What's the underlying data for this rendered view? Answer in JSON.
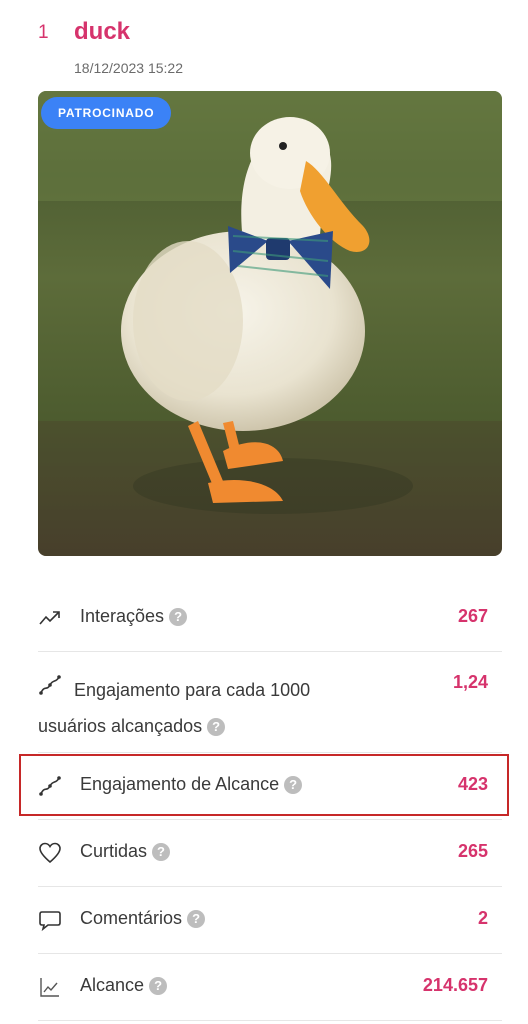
{
  "post": {
    "rank": "1",
    "title": "duck",
    "date": "18/12/2023 15:22",
    "badge": "PATROCINADO"
  },
  "metrics": [
    {
      "label": "Interações",
      "value": "267",
      "icon": "trend-up-icon"
    },
    {
      "label": "Engajamento para cada 1000 usuários alcançados",
      "value": "1,24",
      "icon": "engagement-curve-icon"
    },
    {
      "label": "Engajamento de Alcance",
      "value": "423",
      "icon": "engagement-curve-icon"
    },
    {
      "label": "Curtidas",
      "value": "265",
      "icon": "heart-icon"
    },
    {
      "label": "Comentários",
      "value": "2",
      "icon": "comment-icon"
    },
    {
      "label": "Alcance",
      "value": "214.657",
      "icon": "reach-chart-icon"
    }
  ],
  "help_glyph": "?",
  "colors": {
    "accent": "#d6336c",
    "badge": "#3b82f6",
    "highlight_border": "#c62828"
  }
}
